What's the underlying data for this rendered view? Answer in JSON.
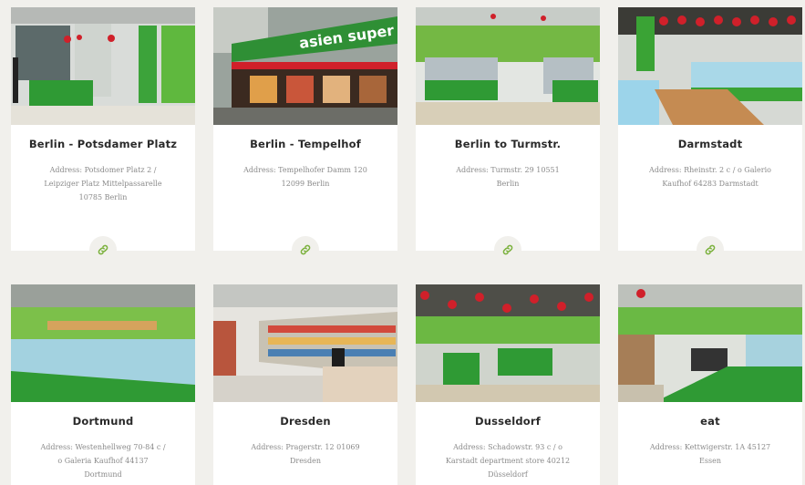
{
  "stores": [
    {
      "name": "Berlin - Potsdamer Platz",
      "address": "Address: Potsdomer Platz 2 / Leipziger Platz Mittelpassarelle 10785 Berlin"
    },
    {
      "name": "Berlin - Tempelhof",
      "address": "Address: Tempelhofer Damm 120 12099 Berlin"
    },
    {
      "name": "Berlin to Turmstr.",
      "address": "Address: Turmstr. 29 10551 Berlin"
    },
    {
      "name": "Darmstadt",
      "address": "Address: Rheinstr. 2 c / o Galerio Kaufhof 64283 Darmstadt"
    },
    {
      "name": "Dortmund",
      "address": "Address: Westenhellweg 70-84 c / o Galeria Kaufhof 44137 Dortmund"
    },
    {
      "name": "Dresden",
      "address": "Address: Pragerstr. 12 01069 Dresden"
    },
    {
      "name": "Dusseldorf",
      "address": "Address: Schadowstr. 93 c / o Karstadt department store 40212 Düsseldorf"
    },
    {
      "name": "eat",
      "address": "Address: Kettwigerstr. 1A 45127 Essen"
    }
  ],
  "sign_text": "asien super",
  "icons": {
    "link": "link-icon"
  },
  "colors": {
    "accent_green": "#7bb13d",
    "brand_green": "#3aa335",
    "lantern_red": "#d0202a"
  }
}
